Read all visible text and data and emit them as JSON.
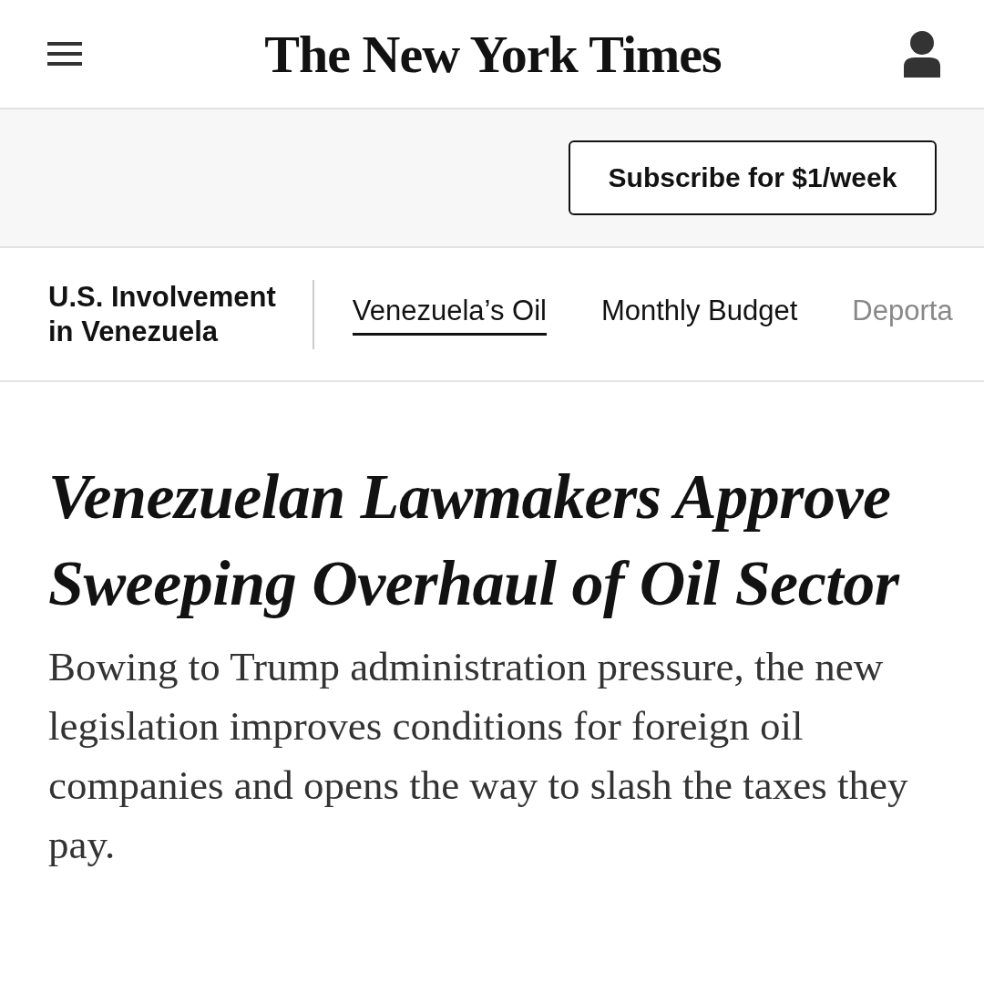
{
  "header": {
    "logo": "The New York Times"
  },
  "subscribe": {
    "label": "Subscribe for $1/week"
  },
  "topic_nav": {
    "title_lines": [
      "U.S. Involvement",
      "in Venezuela"
    ],
    "tabs": [
      {
        "label": "Venezuela’s Oil",
        "selected": true
      },
      {
        "label": "Monthly Budget",
        "selected": false
      },
      {
        "label": "Deporta",
        "selected": false
      }
    ]
  },
  "article": {
    "headline": "Venezuelan Lawmakers Approve Sweeping Overhaul of Oil Sector",
    "summary": "Bowing to Trump administration pressure, the new legislation improves conditions for foreign oil companies and opens the way to slash the taxes they pay."
  }
}
